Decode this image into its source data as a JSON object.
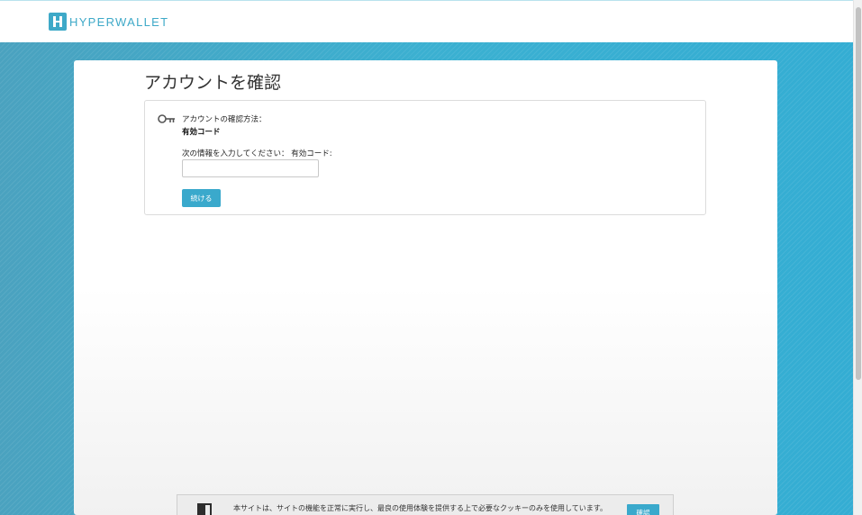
{
  "header": {
    "logo_icon": "hyperwallet-logo-icon",
    "logo_text": "HYPERWALLET"
  },
  "page": {
    "title": "アカウントを確認"
  },
  "verify": {
    "icon": "key-icon",
    "method_label": "アカウントの確認方法：",
    "method_value": "有効コード",
    "input_label": "次の情報を入力してください： 有効コード:",
    "input_value": "",
    "input_placeholder": "",
    "continue_label": "続ける"
  },
  "cookie": {
    "icon": "door-icon",
    "message": "本サイトは、サイトの機能を正常に実行し、最良の使用体験を提供する上で必要なクッキーのみを使用しています。",
    "button_label": "確認"
  },
  "colors": {
    "accent": "#3aa9cc",
    "background_band": "#3bb0d1",
    "card": "#ffffff"
  }
}
